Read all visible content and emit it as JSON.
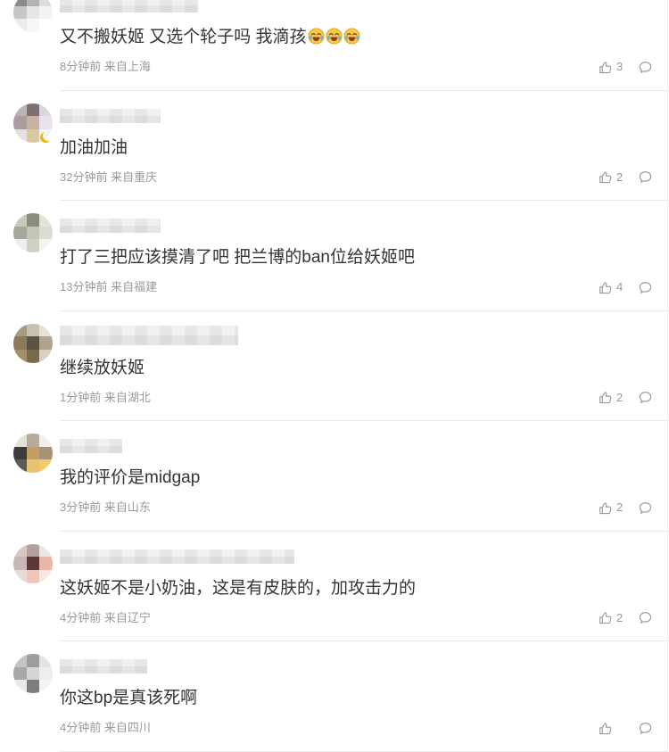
{
  "colors": {
    "text": "#333333",
    "meta": "#999999",
    "divider": "#e8e8e8",
    "emoji": "#f7c948"
  },
  "icons": {
    "like": "thumbs-up-icon",
    "reply": "comment-icon",
    "emoji": "laugh-cry-icon",
    "badge": "moon-badge-icon"
  },
  "comments": [
    {
      "text": "又不搬妖姬 又选个轮子吗 我滴孩",
      "emoji": [
        "laugh-cry-icon",
        "laugh-cry-icon",
        "laugh-cry-icon"
      ],
      "meta": "8分钟前 来自上海",
      "likes": "3",
      "avatar_colors": [
        "#8a8a8a",
        "#b4b4b4",
        "#dedede",
        "#c7c7c7",
        "#e6e6e6",
        "#f3f3f3",
        "#ececec",
        "#f7f7f7",
        "#ffffff"
      ]
    },
    {
      "text": "加油加油",
      "meta": "32分钟前 来自重庆",
      "likes": "2",
      "avatar_colors": [
        "#b9b3bb",
        "#7d6f72",
        "#dcd6e2",
        "#a99e9b",
        "#c7b2a3",
        "#e8e3ea",
        "#e6e1e8",
        "#d9c9a0",
        "#f5f2f6"
      ]
    },
    {
      "text": "打了三把应该摸清了吧 把兰博的ban位给妖姬吧",
      "meta": "13分钟前 来自福建",
      "likes": "4",
      "avatar_colors": [
        "#c9cabd",
        "#8b8c7f",
        "#e3e3da",
        "#a7a89b",
        "#c5c6b8",
        "#dcdcd2",
        "#eeeeea",
        "#cfd0c4",
        "#f4f4f0"
      ]
    },
    {
      "text": "继续放妖姬",
      "meta": "1分钟前 来自湖北",
      "likes": "2",
      "avatar_colors": [
        "#a89a82",
        "#c8c0b0",
        "#e6e2da",
        "#8c7a5c",
        "#5c5343",
        "#b0a48e",
        "#a08e6c",
        "#7a6a4c",
        "#d9d1c2"
      ]
    },
    {
      "text": "我的评价是midgap",
      "meta": "3分钟前 来自山东",
      "likes": "2",
      "avatar_colors": [
        "#e4e0da",
        "#b8aa98",
        "#f2efe9",
        "#3b3b3b",
        "#c69d63",
        "#a7927a",
        "#5b5b5b",
        "#e8c36b",
        "#f2cc6c"
      ]
    },
    {
      "text": "这妖姬不是小奶油，这是有皮肤的，加攻击力的",
      "meta": "4分钟前 来自辽宁",
      "likes": "2",
      "avatar_colors": [
        "#d8c8c4",
        "#b5a09b",
        "#eee6e4",
        "#c9b7b3",
        "#5a3834",
        "#e9b6a9",
        "#e8dcd9",
        "#f0c6bb",
        "#f6e7e3"
      ]
    },
    {
      "text": "你这bp是真该死啊",
      "meta": "4分钟前 来自四川",
      "avatar_colors": [
        "#c4c4c4",
        "#9d9d9d",
        "#e4e4e4",
        "#a8a8a8",
        "#d6d6d6",
        "#eeeeee",
        "#e9e9e9",
        "#7e7e7e",
        "#f4f4f4"
      ]
    }
  ]
}
